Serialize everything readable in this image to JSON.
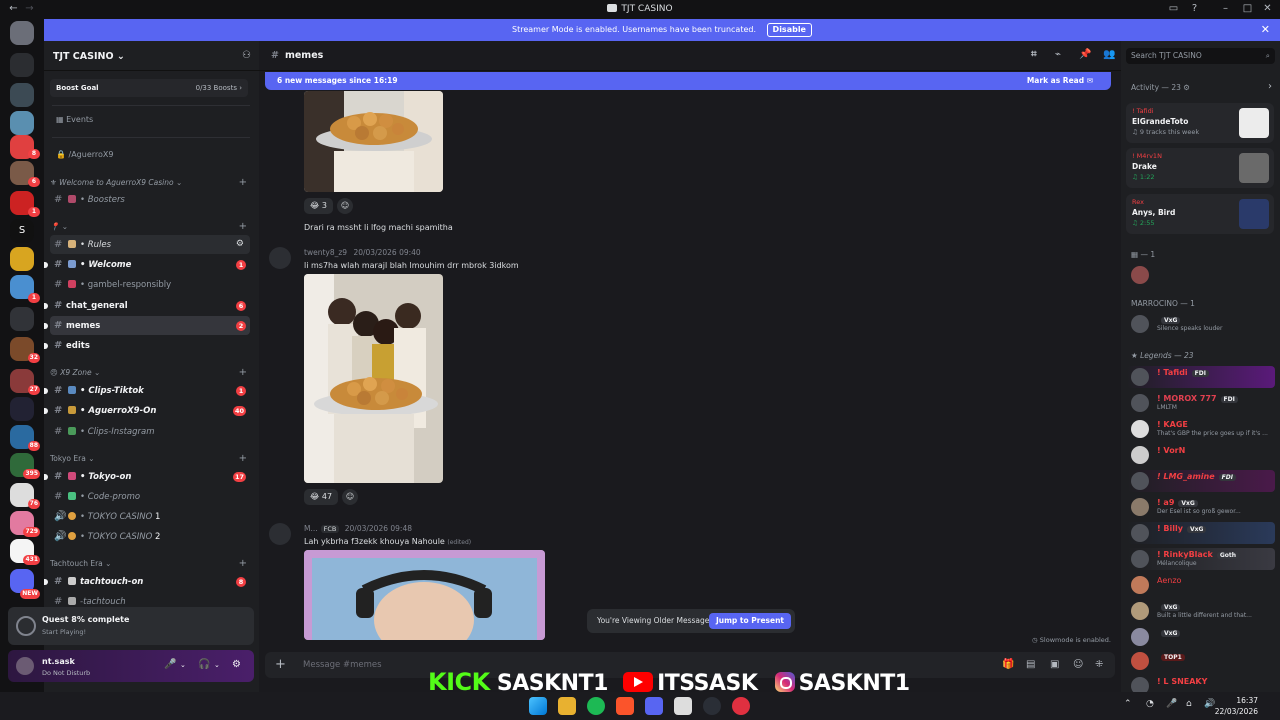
{
  "window": {
    "title": "TJT CASINO"
  },
  "banner": {
    "text": "Streamer Mode is enabled. Usernames have been truncated.",
    "disable_label": "Disable"
  },
  "rail": {
    "badges": [
      "8",
      "6",
      "1",
      "1",
      "32",
      "27",
      "88",
      "395",
      "76",
      "729",
      "431",
      "NEW"
    ],
    "srv_letter": "S"
  },
  "server": {
    "name": "TJT CASINO",
    "boost_goal_label": "Boost Goal",
    "boost_count": "0/33 Boosts",
    "events_label": "Events",
    "private_channel": "/AguerroX9"
  },
  "categories": {
    "welcome": "Welcome to AguerroX9 Casino",
    "x9zone": "X9 Zone",
    "tokyo": "Tokyo Era",
    "tachtouch": "Tachtouch Era"
  },
  "channels": {
    "boosters": "Boosters",
    "rules": "Rules",
    "welcome": "Welcome",
    "welcome_count": "1",
    "gambel": "gambel-responsibly",
    "chat_general": "chat_general",
    "chat_general_count": "6",
    "memes": "memes",
    "memes_count": "2",
    "edits": "edits",
    "clips_tiktok": "Clips-Tiktok",
    "clips_tiktok_count": "1",
    "aguerro_on": "AguerroX9-On",
    "aguerro_on_count": "40",
    "clips_instagram": "Clips-Instagram",
    "tokyo_on": "Tokyo-on",
    "tokyo_on_count": "17",
    "code_promo": "Code-promo",
    "tokyo_casino_1": "TOKYO CASINO",
    "tokyo_casino_1_num": "1",
    "tokyo_casino_2": "TOKYO CASINO",
    "tokyo_casino_2_num": "2",
    "tachtouch_on": "tachtouch-on",
    "tachtouch_on_count": "8",
    "tachtouch": "-tachtouch"
  },
  "quest": {
    "title": "Quest 8% complete",
    "subtitle": "Start Playing!"
  },
  "user": {
    "name": "nt.sask",
    "status": "Do Not Disturb"
  },
  "channel_header": {
    "name": "memes"
  },
  "new_messages": {
    "text": "6 new messages since 16:19",
    "mark_read": "Mark as Read"
  },
  "messages": [
    {
      "reaction_emoji": "😂",
      "reaction_count": "3",
      "text": "Drari ra mssht li lfog machi spamitha"
    },
    {
      "author": "twenty8_z9",
      "timestamp": "20/03/2026 09:40",
      "text": "li ms7ha wlah marajl blah lmouhim drr mbrok 3idkom",
      "reaction_emoji": "😂",
      "reaction_count": "47"
    },
    {
      "author": "M...",
      "tag": "FCB",
      "timestamp": "20/03/2026 09:48",
      "text": "Lah ykbrha f3zekk khouya Nahoule",
      "edited": "(edited)"
    }
  ],
  "older_messages": {
    "text": "You're Viewing Older Messages",
    "jump": "Jump to Present"
  },
  "slowmode": "Slowmode is enabled.",
  "composer": {
    "placeholder": "Message #memes"
  },
  "search": {
    "placeholder": "Search TJT CASINO"
  },
  "activity": {
    "title": "Activity — 23",
    "cards": [
      {
        "user": "! Tafidi",
        "name": "ElGrandeToto",
        "detail": "9 tracks this week"
      },
      {
        "user": "! M4rv1N",
        "name": "Drake",
        "detail": "1:22"
      },
      {
        "user": "Rex",
        "name": "Anys, Bird",
        "detail": "2:55"
      }
    ]
  },
  "members": {
    "section_1": "— 1",
    "marrocino": "MARROCINO — 1",
    "marrocino_member": {
      "badge": "VxG",
      "status": "Silence speaks louder"
    },
    "legends": "Legends — 23",
    "list": [
      {
        "name": "! Tafidi",
        "badge": "FDI",
        "status": ""
      },
      {
        "name": "! MOROX 777",
        "badge": "FDI",
        "status": "LMLTM"
      },
      {
        "name": "! KAGE",
        "badge": "",
        "status": "That's GBP the price goes up if it's ..."
      },
      {
        "name": "! VorN",
        "badge": "",
        "status": ""
      },
      {
        "name": "! LMG_amine",
        "badge": "FDI",
        "status": ""
      },
      {
        "name": "! a9",
        "badge": "VxG",
        "status": "Der Esel ist so groß gewor..."
      },
      {
        "name": "! Billy",
        "badge": "VxG",
        "status": ""
      },
      {
        "name": "! RinkyBlack",
        "badge": "Goth",
        "status": "Mélancolique"
      },
      {
        "name": "Aenzo",
        "badge": "",
        "status": ""
      },
      {
        "name": "",
        "badge": "VxG",
        "status": "Built a little different and that..."
      },
      {
        "name": "",
        "badge": "VxG",
        "status": ""
      },
      {
        "name": "",
        "badge": "TOP1",
        "status": ""
      },
      {
        "name": "! L SNEAKY",
        "badge": "",
        "status": ""
      }
    ]
  },
  "overlay": {
    "kick": "KICK",
    "kick_handle": "SASKNT1",
    "youtube_handle": "ITSSASK",
    "instagram_handle": "SASKNT1"
  },
  "taskbar": {
    "time": "16:37",
    "date": "22/03/2026"
  },
  "colors": {
    "blurple": "#5865f2",
    "red": "#f23f43",
    "green": "#23a55a",
    "kick_green": "#53fc18"
  }
}
